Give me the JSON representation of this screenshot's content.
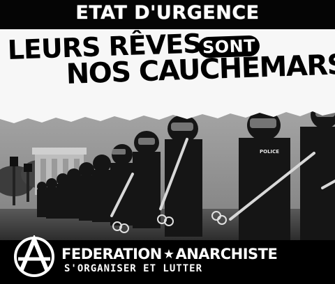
{
  "header": {
    "title": "ETAT D'URGENCE"
  },
  "headline": {
    "line1": "LEURS RÊVES",
    "connector": "SONT",
    "line2": "NOS CAUCHEMARS"
  },
  "photo": {
    "subject_icon": "riot-police-line-illustration",
    "badge_text": "POLICE"
  },
  "footer": {
    "logo_icon": "anarchy-symbol-icon",
    "org_name_part1": "FEDERATION",
    "star_glyph": "★",
    "org_name_part2": "ANARCHISTE",
    "slogan": "S'ORGANISER ET LUTTER"
  },
  "colors": {
    "ink": "#000000",
    "paper": "#f7f7f7",
    "photo_tone": "#7a7a7a",
    "text_light": "#ffffff"
  }
}
